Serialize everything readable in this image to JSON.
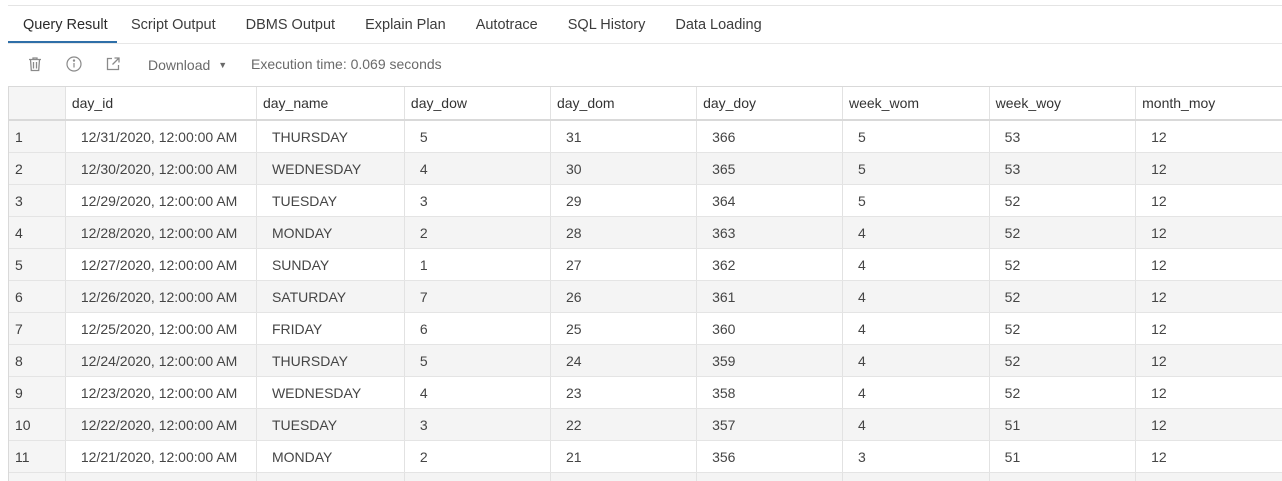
{
  "tabs": [
    {
      "label": "Query Result",
      "active": true
    },
    {
      "label": "Script Output"
    },
    {
      "label": "DBMS Output"
    },
    {
      "label": "Explain Plan"
    },
    {
      "label": "Autotrace"
    },
    {
      "label": "SQL History"
    },
    {
      "label": "Data Loading"
    }
  ],
  "toolbar": {
    "delete_icon": "trash-icon",
    "info_icon": "info-icon",
    "open_icon": "open-in-new-icon",
    "download_label": "Download",
    "download_caret": "▼",
    "execution_time": "Execution time: 0.069 seconds"
  },
  "grid": {
    "columns": [
      "",
      "day_id",
      "day_name",
      "day_dow",
      "day_dom",
      "day_doy",
      "week_wom",
      "week_woy",
      "month_moy"
    ],
    "rows": [
      [
        "1",
        "12/31/2020, 12:00:00 AM",
        "THURSDAY",
        "5",
        "31",
        "366",
        "5",
        "53",
        "12"
      ],
      [
        "2",
        "12/30/2020, 12:00:00 AM",
        "WEDNESDAY",
        "4",
        "30",
        "365",
        "5",
        "53",
        "12"
      ],
      [
        "3",
        "12/29/2020, 12:00:00 AM",
        "TUESDAY",
        "3",
        "29",
        "364",
        "5",
        "52",
        "12"
      ],
      [
        "4",
        "12/28/2020, 12:00:00 AM",
        "MONDAY",
        "2",
        "28",
        "363",
        "4",
        "52",
        "12"
      ],
      [
        "5",
        "12/27/2020, 12:00:00 AM",
        "SUNDAY",
        "1",
        "27",
        "362",
        "4",
        "52",
        "12"
      ],
      [
        "6",
        "12/26/2020, 12:00:00 AM",
        "SATURDAY",
        "7",
        "26",
        "361",
        "4",
        "52",
        "12"
      ],
      [
        "7",
        "12/25/2020, 12:00:00 AM",
        "FRIDAY",
        "6",
        "25",
        "360",
        "4",
        "52",
        "12"
      ],
      [
        "8",
        "12/24/2020, 12:00:00 AM",
        "THURSDAY",
        "5",
        "24",
        "359",
        "4",
        "52",
        "12"
      ],
      [
        "9",
        "12/23/2020, 12:00:00 AM",
        "WEDNESDAY",
        "4",
        "23",
        "358",
        "4",
        "52",
        "12"
      ],
      [
        "10",
        "12/22/2020, 12:00:00 AM",
        "TUESDAY",
        "3",
        "22",
        "357",
        "4",
        "51",
        "12"
      ],
      [
        "11",
        "12/21/2020, 12:00:00 AM",
        "MONDAY",
        "2",
        "21",
        "356",
        "3",
        "51",
        "12"
      ],
      [
        "",
        "",
        "",
        "",
        "",
        "",
        "",
        "",
        ""
      ]
    ]
  },
  "colors": {
    "active_tab_underline": "#2e6fa8",
    "stripe": "#f4f4f4"
  }
}
